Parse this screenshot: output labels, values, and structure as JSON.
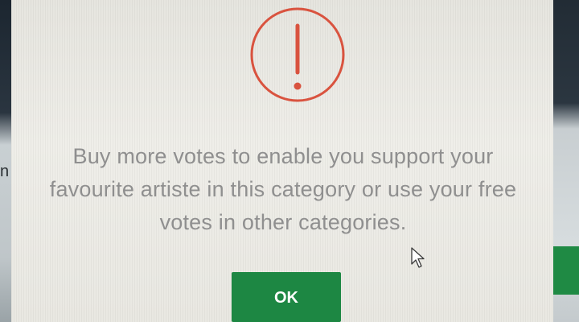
{
  "dialog": {
    "icon": "exclamation-circle-icon",
    "message_lines": [
      "Buy more votes to enable you support your",
      "favourite artiste in this category or use your free",
      "votes in other categories."
    ],
    "ok_label": "OK"
  },
  "background": {
    "left_partial_text": "n"
  },
  "colors": {
    "alert_red": "#d9533f",
    "button_green": "#1d8743",
    "dialog_bg": "#ecebe6",
    "message_gray": "#8f8f8f"
  },
  "pointer": "mouse-pointer-icon"
}
